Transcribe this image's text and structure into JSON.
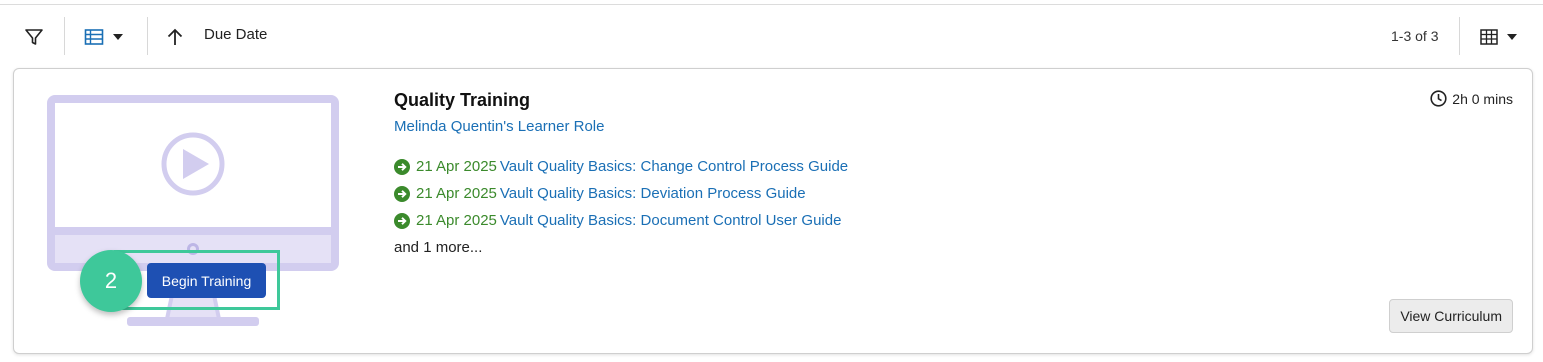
{
  "toolbar": {
    "sort_label": "Due Date",
    "pager_text": "1-3 of 3"
  },
  "card": {
    "title": "Quality Training",
    "role": "Melinda Quentin's Learner Role",
    "duration": "2h 0 mins",
    "items": [
      {
        "date": "21 Apr 2025",
        "label": "Vault Quality Basics: Change Control Process Guide"
      },
      {
        "date": "21 Apr 2025",
        "label": "Vault Quality Basics: Deviation Process Guide"
      },
      {
        "date": "21 Apr 2025",
        "label": "Vault Quality Basics: Document Control User Guide"
      }
    ],
    "more_text": "and 1 more...",
    "view_button": "View Curriculum",
    "begin_button": "Begin Training"
  },
  "annotation": {
    "step_number": "2",
    "color": "#3ec89a"
  },
  "colors": {
    "link": "#1a6fb5",
    "date_green": "#3b8a2c",
    "primary_button": "#1e50b3",
    "illustration_purple": "#d2cdef"
  },
  "icons": [
    "filter-icon",
    "list-view-icon",
    "sort-ascending-icon",
    "grid-view-icon",
    "clock-icon",
    "arrow-circle-icon",
    "play-icon"
  ]
}
